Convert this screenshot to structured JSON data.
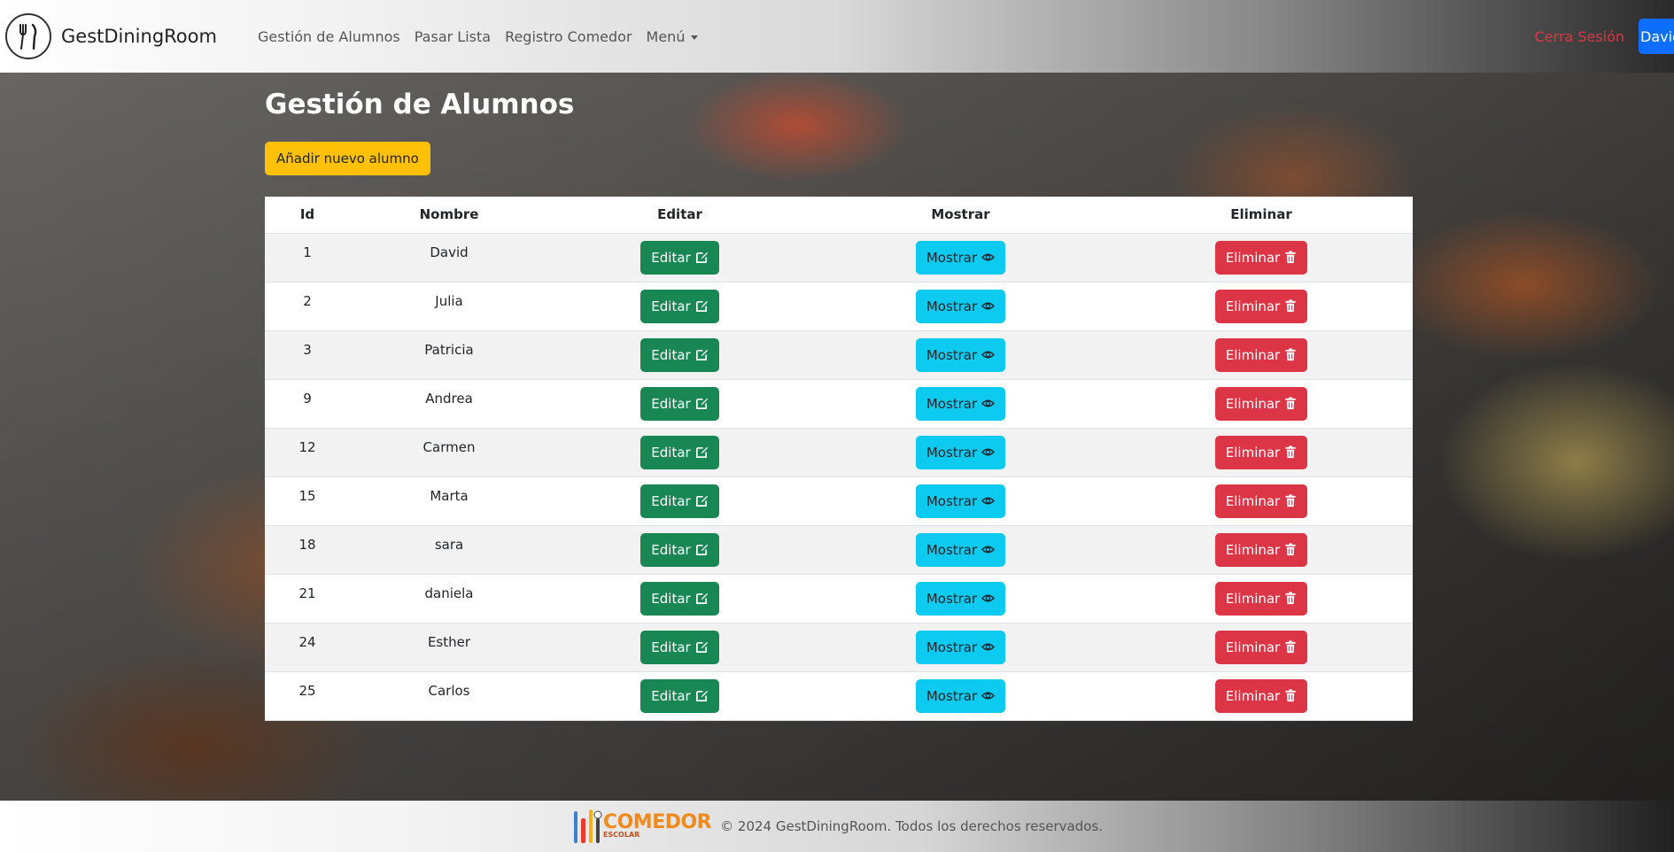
{
  "navbar": {
    "brand": "GestDiningRoom",
    "links": [
      "Gestión de Alumnos",
      "Pasar Lista",
      "Registro Comedor",
      "Menú"
    ],
    "logout": "Cerra Sesión",
    "user": "David"
  },
  "main": {
    "title": "Gestión de Alumnos",
    "add_button": "Añadir nuevo alumno",
    "table": {
      "headers": [
        "Id",
        "Nombre",
        "Editar",
        "Mostrar",
        "Eliminar"
      ],
      "rows": [
        {
          "id": "1",
          "name": "David"
        },
        {
          "id": "2",
          "name": "Julia"
        },
        {
          "id": "3",
          "name": "Patricia"
        },
        {
          "id": "9",
          "name": "Andrea"
        },
        {
          "id": "12",
          "name": "Carmen"
        },
        {
          "id": "15",
          "name": "Marta"
        },
        {
          "id": "18",
          "name": "sara"
        },
        {
          "id": "21",
          "name": "daniela"
        },
        {
          "id": "24",
          "name": "Esther"
        },
        {
          "id": "25",
          "name": "Carlos"
        }
      ],
      "edit_label": "Editar",
      "show_label": "Mostrar",
      "delete_label": "Eliminar"
    }
  },
  "footer": {
    "logo_word": "COMEDOR",
    "logo_sub": "ESCOLAR",
    "text": "© 2024 GestDiningRoom. Todos los derechos reservados."
  },
  "icons": {
    "edit": "pencil-square-icon",
    "show": "eye-icon",
    "delete": "trash-icon"
  },
  "colors": {
    "add": "#ffc107",
    "edit": "#198754",
    "show": "#0dcaf0",
    "delete": "#dc3545",
    "user": "#0d6efd"
  }
}
